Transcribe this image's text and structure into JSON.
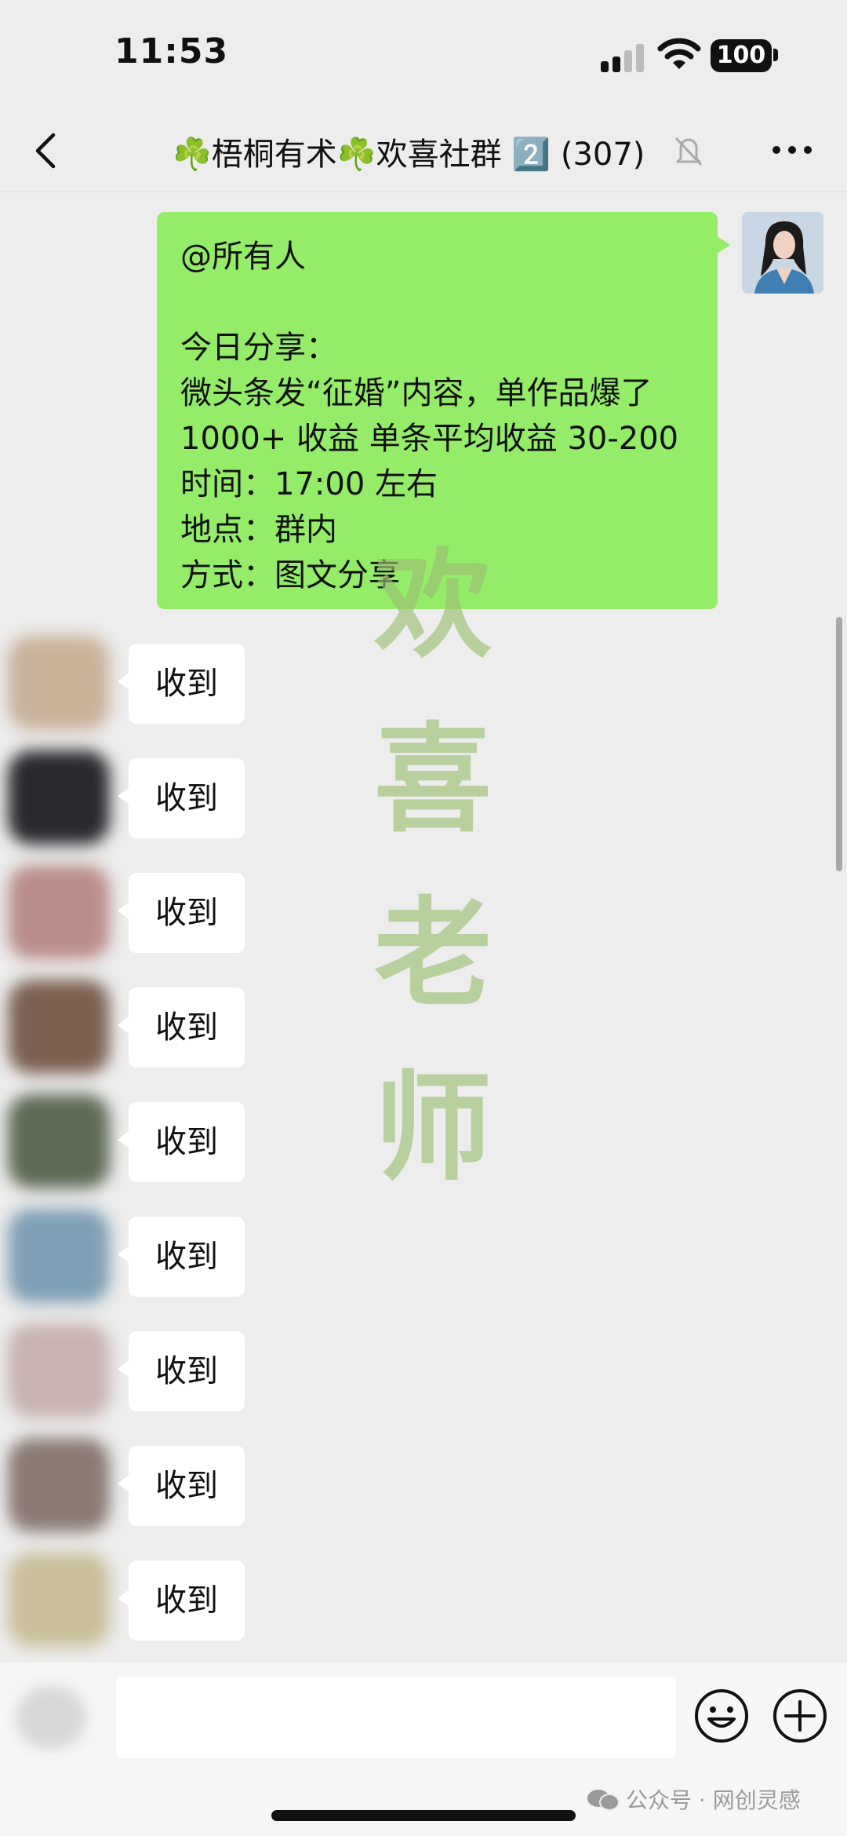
{
  "status_bar": {
    "time": "11:53",
    "battery": "100"
  },
  "nav": {
    "title": "☘️梧桐有术☘️欢喜社群 2️⃣ (307)"
  },
  "self_message": {
    "text": "@所有人\n\n今日分享：\n微头条发“征婚”内容，单作品爆了\n1000+ 收益 单条平均收益 30-200\n时间：17:00 左右\n地点：群内\n方式：图文分享"
  },
  "replies": [
    {
      "text": "收到",
      "avatar_color": "#c8b29a"
    },
    {
      "text": "收到",
      "avatar_color": "#2a2a2e"
    },
    {
      "text": "收到",
      "avatar_color": "#b98e8a"
    },
    {
      "text": "收到",
      "avatar_color": "#7c6152"
    },
    {
      "text": "收到",
      "avatar_color": "#5e6a55"
    },
    {
      "text": "收到",
      "avatar_color": "#7e9fb4"
    },
    {
      "text": "收到",
      "avatar_color": "#c7b3b1"
    },
    {
      "text": "收到",
      "avatar_color": "#8a7a74"
    },
    {
      "text": "收到",
      "avatar_color": "#c9bf9a"
    }
  ],
  "watermark": {
    "chars": [
      "欢",
      "喜",
      "老",
      "师"
    ]
  },
  "footer": {
    "source": "公众号 · 网创灵感"
  }
}
